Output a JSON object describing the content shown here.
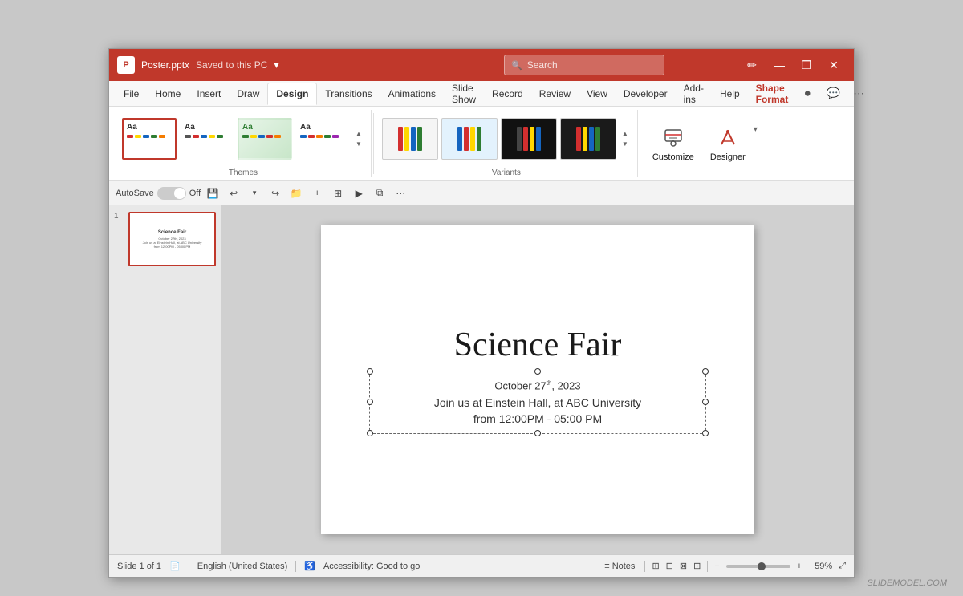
{
  "titleBar": {
    "appIcon": "P",
    "fileName": "Poster.pptx",
    "savedStatus": "Saved to this PC",
    "dropdownArrow": "▾",
    "searchPlaceholder": "Search",
    "penIcon": "✏",
    "minimizeIcon": "—",
    "restoreIcon": "❐",
    "closeIcon": "✕"
  },
  "ribbon": {
    "tabs": [
      {
        "label": "File",
        "active": false
      },
      {
        "label": "Home",
        "active": false
      },
      {
        "label": "Insert",
        "active": false
      },
      {
        "label": "Draw",
        "active": false
      },
      {
        "label": "Design",
        "active": true
      },
      {
        "label": "Transitions",
        "active": false
      },
      {
        "label": "Animations",
        "active": false
      },
      {
        "label": "Slide Show",
        "active": false
      },
      {
        "label": "Record",
        "active": false
      },
      {
        "label": "Review",
        "active": false
      },
      {
        "label": "View",
        "active": false
      },
      {
        "label": "Developer",
        "active": false
      },
      {
        "label": "Add-ins",
        "active": false
      },
      {
        "label": "Help",
        "active": false
      },
      {
        "label": "Shape Format",
        "active": false,
        "special": true
      }
    ],
    "groups": {
      "themes": {
        "label": "Themes",
        "items": [
          {
            "name": "Office Theme 1",
            "style": "default"
          },
          {
            "name": "Office Theme 2",
            "style": "plain"
          },
          {
            "name": "Office Theme 3",
            "style": "green"
          },
          {
            "name": "Office Theme 4",
            "style": "striped"
          }
        ]
      },
      "variants": {
        "label": "Variants",
        "items": [
          {
            "name": "Variant 1",
            "style": "light"
          },
          {
            "name": "Variant 2",
            "style": "colored"
          },
          {
            "name": "Variant 3",
            "style": "dark1"
          },
          {
            "name": "Variant 4",
            "style": "dark2"
          }
        ]
      },
      "customize": {
        "customizeLabel": "Customize",
        "designerLabel": "Designer"
      }
    }
  },
  "quickAccess": {
    "autosaveLabel": "AutoSave",
    "autosaveState": "Off",
    "saveIcon": "💾",
    "undoIcon": "↩",
    "undoDropIcon": "▾",
    "redoIcon": "↪",
    "openIcon": "📁",
    "printIcon": "🖨",
    "slideViewIcon": "⊡",
    "presentIcon": "▦",
    "shareIcon": "⇧",
    "moreIcon": "⋯"
  },
  "slidesPanel": {
    "slides": [
      {
        "number": "1",
        "title": "Science Fair",
        "text": "October 27th, 2023\nJoin us at Einstein Hall, at ABC University\nfrom 12:00PM - 05:00 PM"
      }
    ]
  },
  "slideContent": {
    "title": "Science Fair",
    "date": "October 27",
    "dateSup": "th",
    "dateYear": ", 2023",
    "subtitle": "Join us at Einstein Hall, at ABC University",
    "time": "from 12:00PM - 05:00 PM"
  },
  "statusBar": {
    "slideInfo": "Slide 1 of 1",
    "language": "English (United States)",
    "accessibility": "Accessibility: Good to go",
    "notesLabel": "Notes",
    "zoomPercent": "59%"
  },
  "watermark": "SLIDEMODEL.COM"
}
